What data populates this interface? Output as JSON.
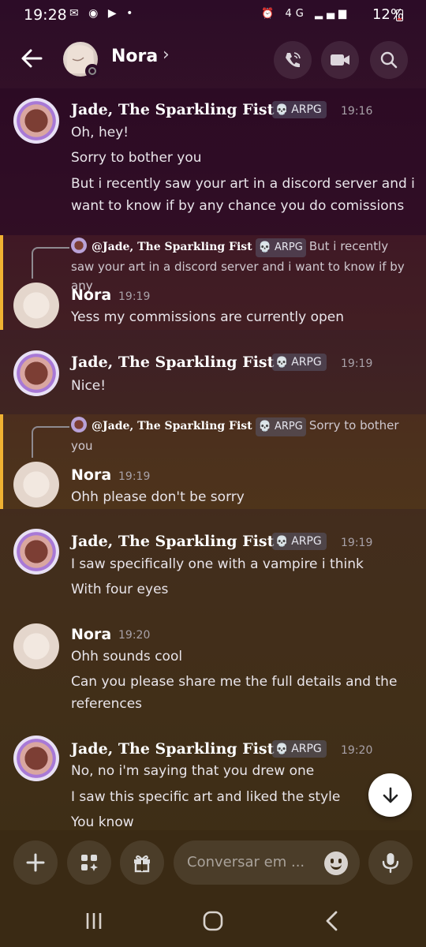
{
  "status_bar": {
    "time": "19:28",
    "battery": "12%",
    "network": "4G"
  },
  "header": {
    "contact_name": "Nora",
    "chevron": "›"
  },
  "messages": [
    {
      "author": "Jade, The Sparkling Fist",
      "tag": "ARPG",
      "time": "19:16",
      "lines": [
        "Oh, hey!",
        "Sorry to bother you",
        "But i recently saw your art in a discord server and i",
        "want to know if by any chance you do comissions"
      ]
    },
    {
      "reply_author": "@Jade, The Sparkling Fist",
      "reply_tag": "ARPG",
      "reply_text": "But i recently saw your art in a discord server and i want to know if by any",
      "author": "Nora",
      "time": "19:19",
      "lines": [
        "Yess my commissions are currently open"
      ]
    },
    {
      "author": "Jade, The Sparkling Fist",
      "tag": "ARPG",
      "time": "19:19",
      "lines": [
        "Nice!"
      ]
    },
    {
      "reply_author": "@Jade, The Sparkling Fist",
      "reply_tag": "ARPG",
      "reply_text": "Sorry to bother you",
      "author": "Nora",
      "time": "19:19",
      "lines": [
        "Ohh please don't be sorry"
      ]
    },
    {
      "author": "Jade, The Sparkling Fist",
      "tag": "ARPG",
      "time": "19:19",
      "lines": [
        "I saw specifically one with a vampire i think",
        "With four eyes"
      ]
    },
    {
      "author": "Nora",
      "time": "19:20",
      "lines": [
        "Ohh sounds cool",
        "Can you please share me the full details and the",
        "references"
      ]
    },
    {
      "author": "Jade, The Sparkling Fist",
      "tag": "ARPG",
      "time": "19:20",
      "lines": [
        "No, no i'm saying that you drew one",
        "I saw this specific art and liked the style",
        "You know"
      ]
    }
  ],
  "composer": {
    "placeholder": "Conversar em ..."
  },
  "icons": {
    "back": "arrow-left-icon",
    "call": "phone-icon",
    "video": "video-camera-icon",
    "search": "search-icon",
    "add": "plus-icon",
    "apps": "apps-icon",
    "gift": "gift-icon",
    "emoji": "emoji-icon",
    "mic": "microphone-icon",
    "scroll_down": "arrow-down-icon",
    "skull": "skull-icon"
  },
  "colors": {
    "reply_accent": "#f0b232",
    "role_tag_bg": "#5a5a6e"
  }
}
